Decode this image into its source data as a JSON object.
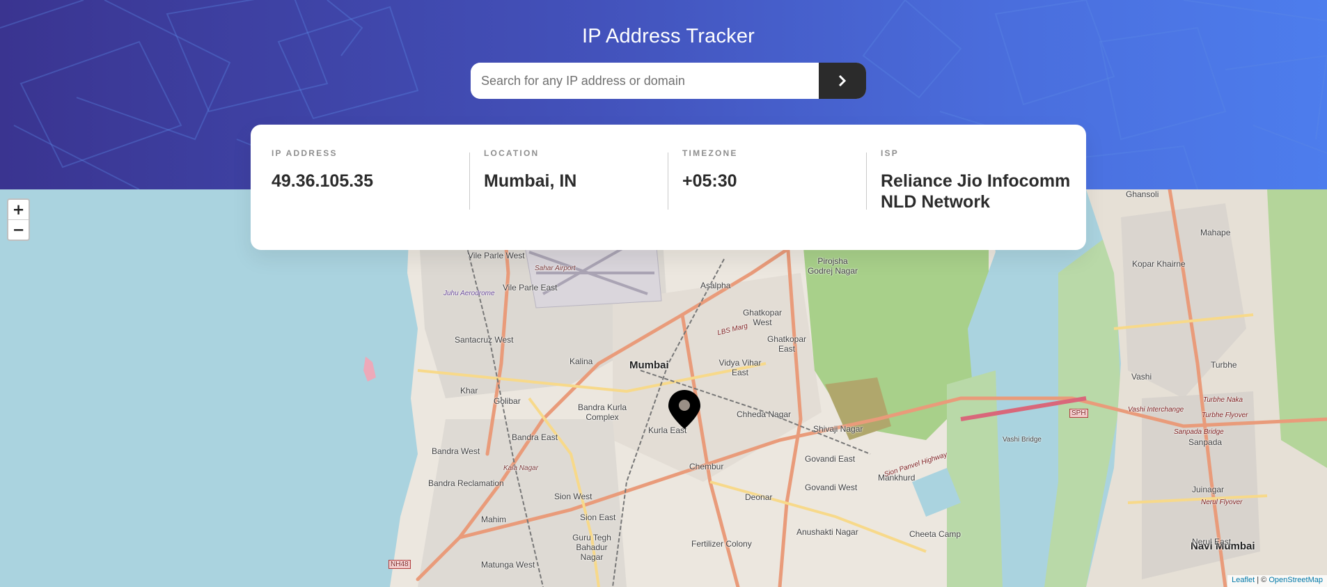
{
  "header": {
    "title": "IP Address Tracker",
    "search": {
      "placeholder": "Search for any IP address or domain",
      "value": ""
    }
  },
  "info": [
    {
      "label": "IP ADDRESS",
      "value": "49.36.105.35"
    },
    {
      "label": "LOCATION",
      "value": "Mumbai, IN"
    },
    {
      "label": "TIMEZONE",
      "value": "+05:30"
    },
    {
      "label": "ISP",
      "value": "Reliance Jio Infocomm NLD Network"
    }
  ],
  "map": {
    "zoom_in": "+",
    "zoom_out": "−",
    "attribution": {
      "leaflet": "Leaflet",
      "separator": " | © ",
      "osm": "OpenStreetMap"
    },
    "places": {
      "mumbai": "Mumbai",
      "navi_mumbai": "Navi Mumbai",
      "kurla_east": "Kurla East",
      "bandra_kurla_complex": "Bandra Kurla Complex",
      "bandra_east": "Bandra East",
      "bandra_west": "Bandra West",
      "bandra_reclamation": "Bandra Reclamation",
      "vile_parle_west": "Vile Parle West",
      "vile_parle_east": "Vile Parle East",
      "santacruz_west": "Santacruz West",
      "kalina": "Kalina",
      "khar": "Khar",
      "golibar": "Golibar",
      "asalpha": "Asalpha",
      "ghatkopar_west": "Ghatkopar West",
      "ghatkopar_east": "Ghatkopar East",
      "vidya_vihar_east": "Vidya Vihar East",
      "chheda_nagar": "Chheda Nagar",
      "shivaji_nagar": "Shivaji Nagar",
      "govandi_east": "Govandi East",
      "govandi_west": "Govandi West",
      "chembur": "Chembur",
      "mankhurd": "Mankhurd",
      "deonar": "Deonar",
      "sion_west": "Sion West",
      "sion_east": "Sion East",
      "mahim": "Mahim",
      "guru_tegh_bahadur_nagar": "Guru Tegh Bahadur Nagar",
      "fertilizer_colony": "Fertilizer Colony",
      "anushakti_nagar": "Anushakti Nagar",
      "cheeta_camp": "Cheeta Camp",
      "matunga_west": "Matunga West",
      "pirojsha_godrej_nagar": "Pirojsha Godrej Nagar",
      "mahape": "Mahape",
      "kopar_khairne": "Kopar Khairne",
      "vashi": "Vashi",
      "turbhe": "Turbhe",
      "sanpada": "Sanpada",
      "juinagar": "Juinagar",
      "nerul_east": "Nerul East",
      "ghansoli": "Ghansoli",
      "kala_nagar": "Kala Nagar",
      "sahar_airport": "Sahar Airport",
      "juhu_aerodrome": "Juhu Aerodrome",
      "vashi_bridge": "Vashi Bridge",
      "nh48": "NH48",
      "sph": "SPH",
      "lbs_marg": "LBS Marg",
      "sion_panvel_highway": "Sion Panvel Highway",
      "turbhe_naka": "Turbhe Naka",
      "turbhe_flyover": "Turbhe Flyover",
      "vashi_interchange": "Vashi Interchange",
      "sanpada_bridge": "Sanpada Bridge",
      "nerul_flyover": "Nerul Flyover"
    }
  }
}
